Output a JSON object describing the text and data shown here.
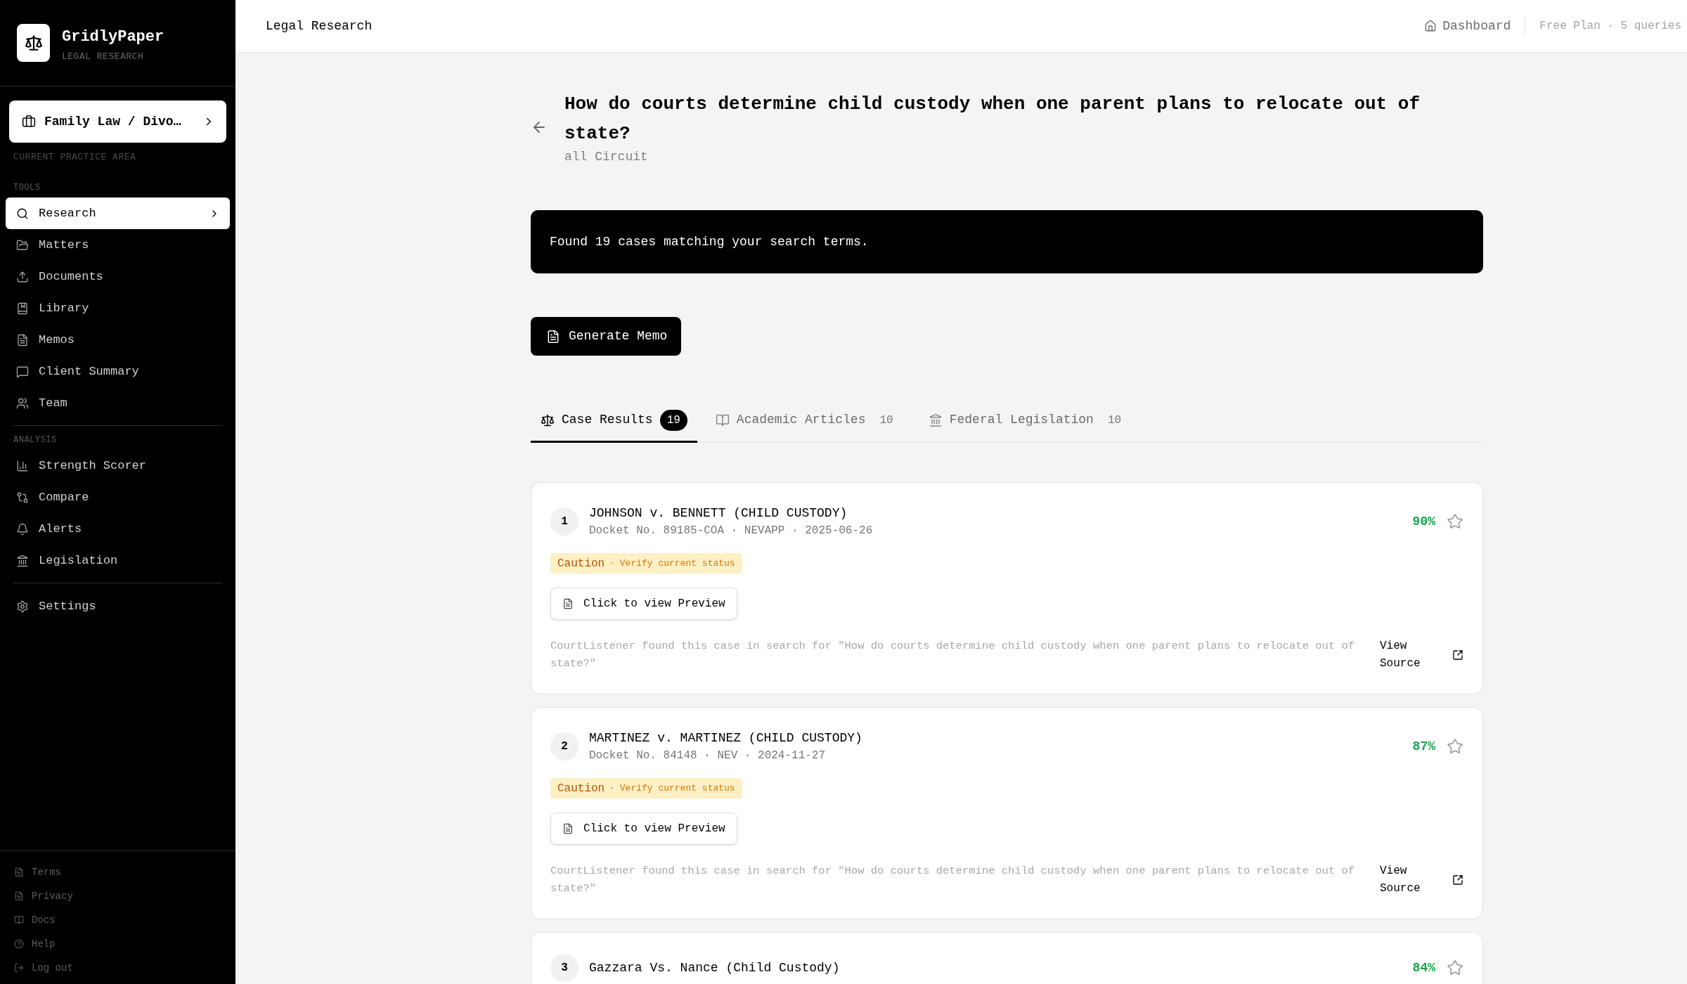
{
  "sidebar": {
    "brand": {
      "name": "GridlyPaper",
      "tagline": "LEGAL RESEARCH"
    },
    "practice_area": {
      "label": "Family Law / Divo…",
      "caption": "CURRENT PRACTICE AREA"
    },
    "sections": [
      {
        "heading": "TOOLS",
        "items": [
          {
            "label": "Research",
            "selected": true
          },
          {
            "label": "Matters",
            "selected": false
          },
          {
            "label": "Documents",
            "selected": false
          },
          {
            "label": "Library",
            "selected": false
          },
          {
            "label": "Memos",
            "selected": false
          },
          {
            "label": "Client Summary",
            "selected": false
          },
          {
            "label": "Team",
            "selected": false
          }
        ]
      },
      {
        "heading": "ANALYSIS",
        "items": [
          {
            "label": "Strength Scorer",
            "selected": false
          },
          {
            "label": "Compare",
            "selected": false
          },
          {
            "label": "Alerts",
            "selected": false
          },
          {
            "label": "Legislation",
            "selected": false
          }
        ]
      },
      {
        "items": [
          {
            "label": "Settings",
            "selected": false
          }
        ]
      }
    ],
    "footer_links": [
      "Terms",
      "Privacy",
      "Docs",
      "Help",
      "Log out"
    ]
  },
  "header": {
    "title": "Legal Research",
    "dashboard_link": "Dashboard",
    "plan": "Free Plan · 5 queries"
  },
  "query": {
    "question": "How do courts determine child custody when one parent plans to relocate out of state?",
    "jurisdiction": "all Circuit"
  },
  "results_banner": "Found 19 cases matching your search terms.",
  "generate_button": "Generate Memo",
  "tabs": [
    {
      "label": "Case Results",
      "count": "19",
      "selected": true
    },
    {
      "label": "Academic Articles",
      "count": "10",
      "selected": false
    },
    {
      "label": "Federal Legislation",
      "count": "10",
      "selected": false
    }
  ],
  "cases": [
    {
      "rank": "1",
      "title": "JOHNSON v. BENNETT (CHILD CUSTODY)",
      "meta": "Docket No. 89185-COA · NEVAPP · 2025-06-26",
      "score": "90%",
      "starred": false,
      "status": {
        "label": "Caution",
        "note": "· Verify current status"
      },
      "preview_button": "Click to view Preview",
      "snippet": "CourtListener found this case in search for \"How do courts determine child custody when one parent plans to relocate out of state?\"",
      "source_link": "View Source"
    },
    {
      "rank": "2",
      "title": "MARTINEZ v. MARTINEZ (CHILD CUSTODY)",
      "meta": "Docket No. 84148 · NEV · 2024-11-27",
      "score": "87%",
      "starred": false,
      "status": {
        "label": "Caution",
        "note": "· Verify current status"
      },
      "preview_button": "Click to view Preview",
      "snippet": "CourtListener found this case in search for \"How do courts determine child custody when one parent plans to relocate out of state?\"",
      "source_link": "View Source"
    },
    {
      "rank": "3",
      "title": "Gazzara Vs. Nance (Child Custody)",
      "score": "84%",
      "starred": false
    }
  ]
}
